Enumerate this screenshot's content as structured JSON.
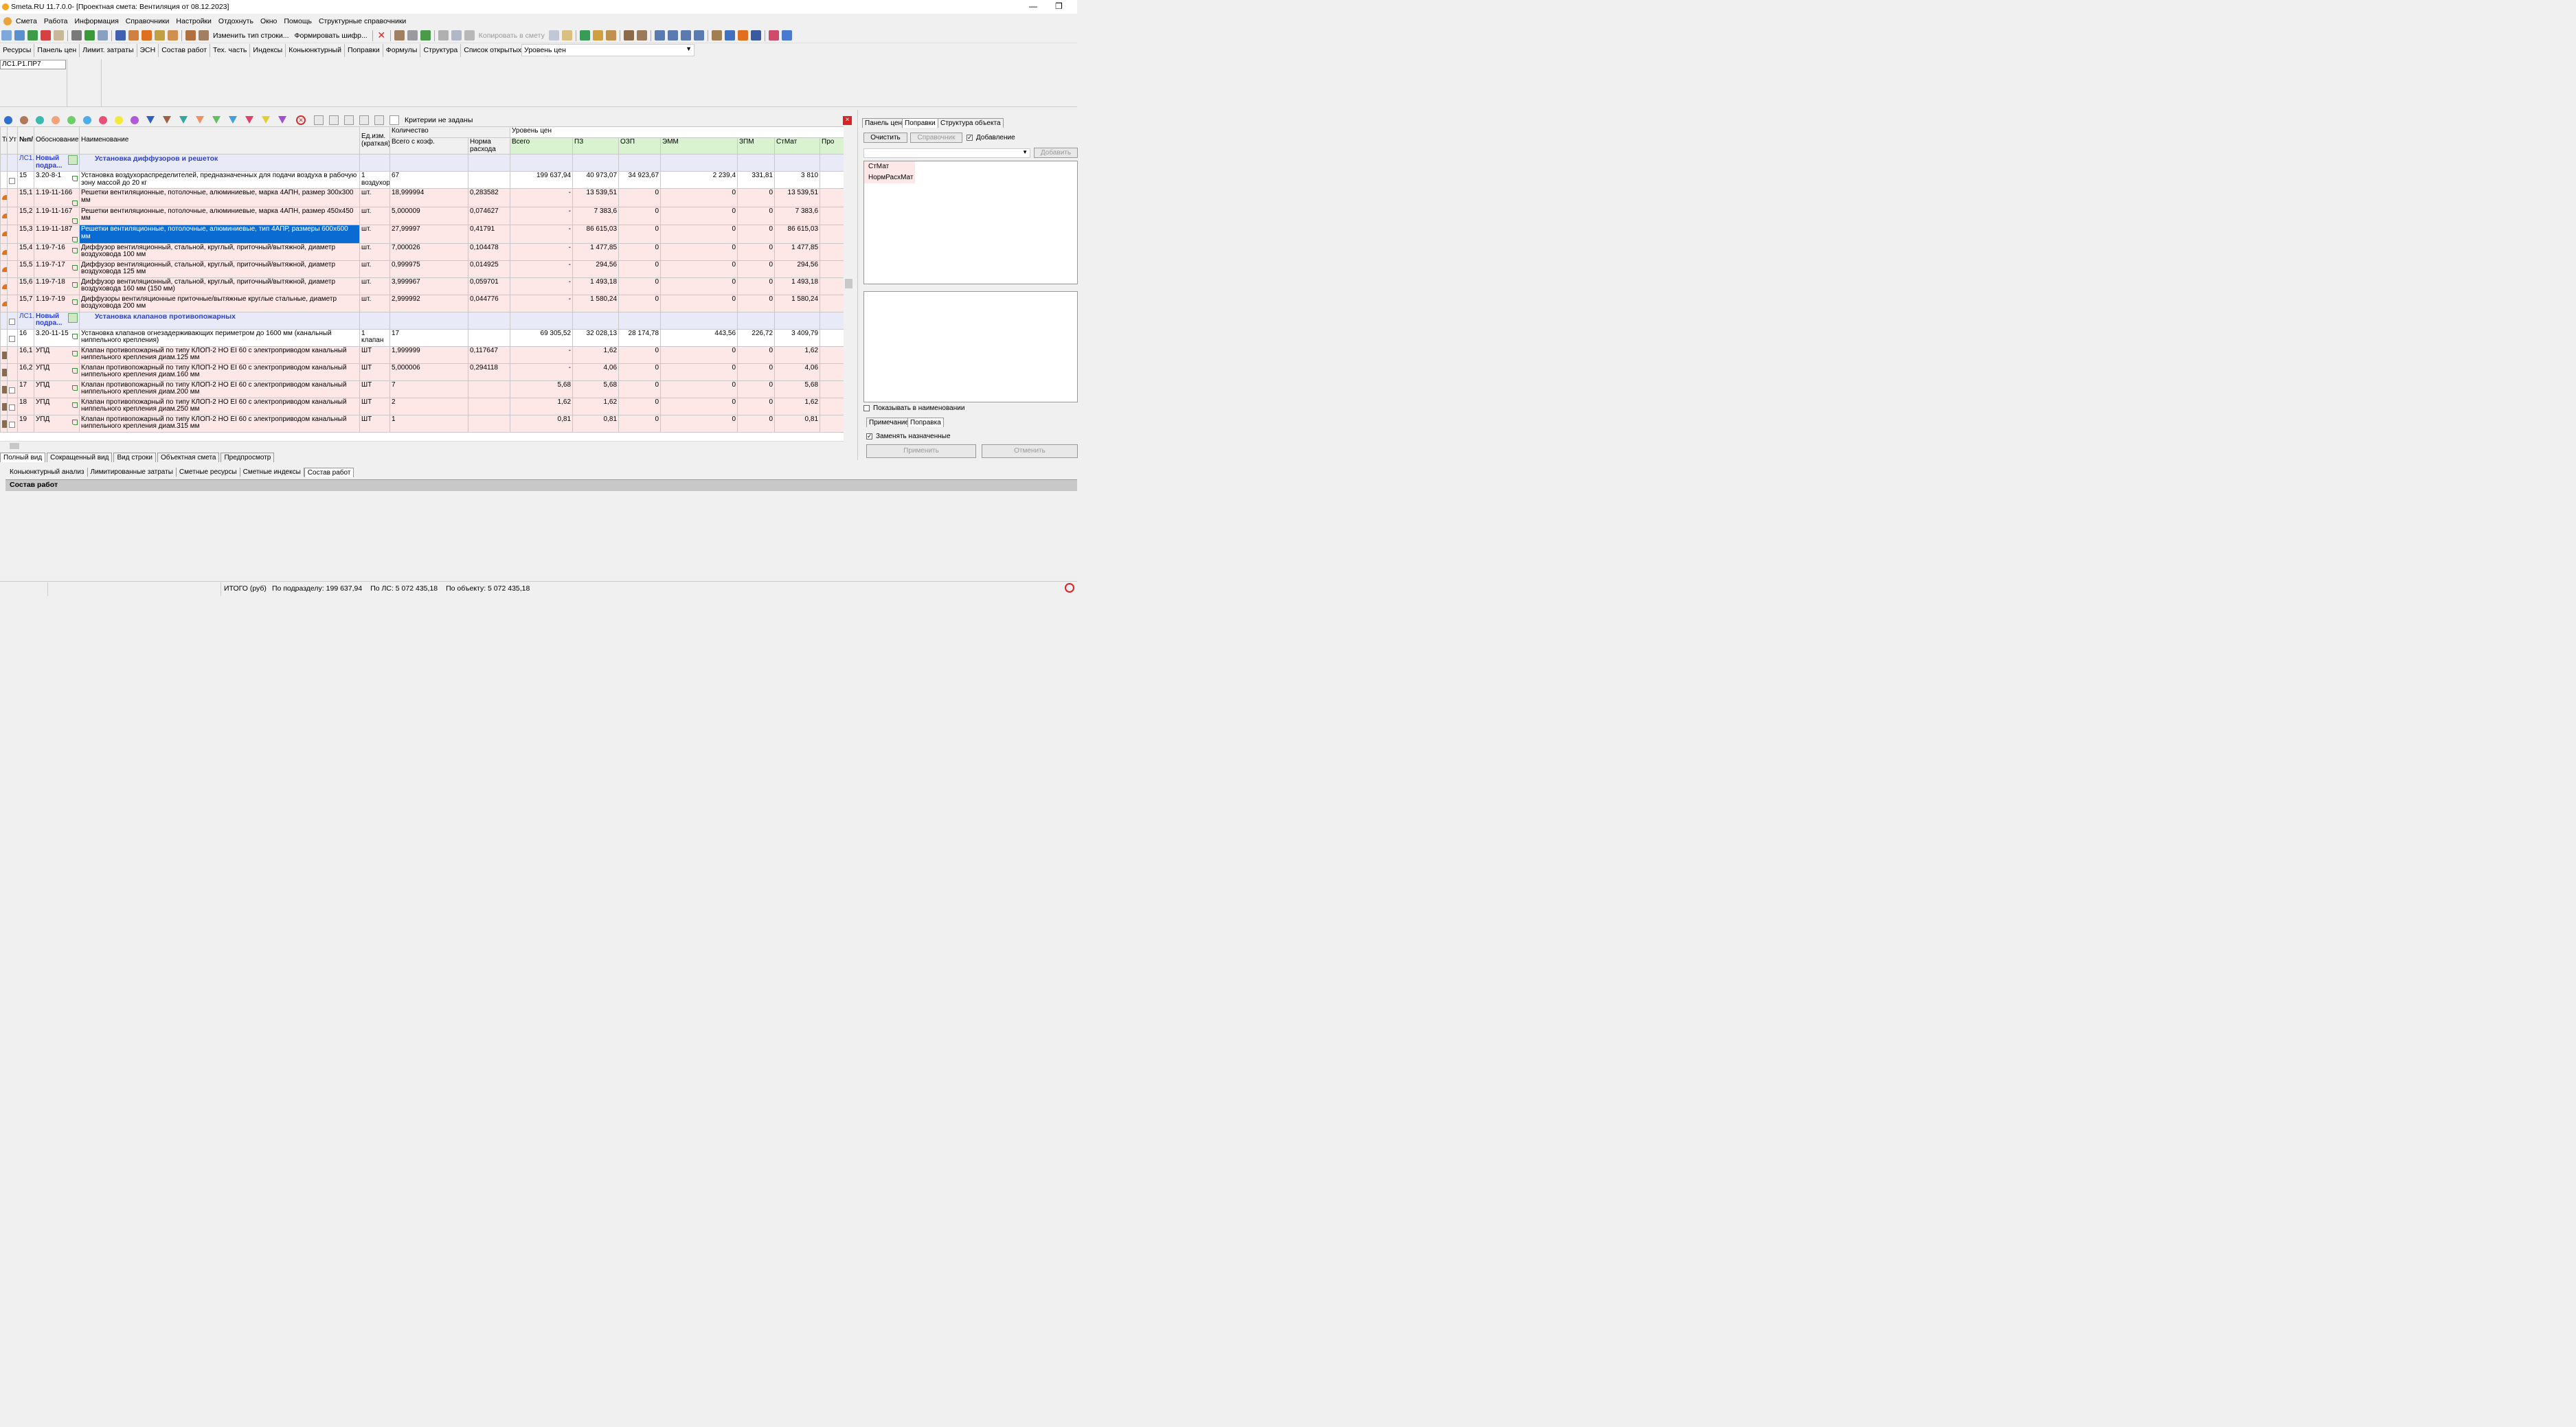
{
  "titlebar": {
    "app": "Smeta.RU  11.7.0.0",
    "doc": "  - [Проектная смета: Вентиляция от 08.12.2023]",
    "minimize": "—",
    "restore": "❐"
  },
  "menu": [
    "Смета",
    "Работа",
    "Информация",
    "Справочники",
    "Настройки",
    "Отдохнуть",
    "Окно",
    "Помощь",
    "Структурные справочники"
  ],
  "toolbar": {
    "change_row_type": "Изменить тип строки...",
    "form_code": "Формировать шифр...",
    "copy_to_estimate": "Копировать в смету"
  },
  "tabs": [
    "Ресурсы",
    "Панель цен",
    "Лимит. затраты",
    "ЭСН",
    "Состав работ",
    "Тех. часть",
    "Индексы",
    "Коньюнктурный",
    "Поправки",
    "Формулы",
    "Структура",
    "Список открытых окон ▾"
  ],
  "price_level_combo": "Уровень цен",
  "breadcrumb": "ЛС1.Р1.ПР7",
  "filter": {
    "dot_colors": [
      "#2f6fd0",
      "#b07a5a",
      "#3bb8b0",
      "#f3a37a",
      "#6fce6a",
      "#4aaee8",
      "#e8507a",
      "#f2ea3a",
      "#b05ad8"
    ],
    "funnel_colors": [
      "#3060c0",
      "#a06040",
      "#30a8a0",
      "#f09060",
      "#60c060",
      "#40a0e0",
      "#e04070",
      "#e0d030",
      "#a050d0"
    ],
    "criteria": "Критерии не заданы",
    "close": "×"
  },
  "grid": {
    "headers": {
      "type": "Ти",
      "ut": "Ут",
      "num": "№п/",
      "basis": "Обоснование",
      "name": "Наименование",
      "unit": "Ед.изм. (краткая)",
      "qty_group": "Количество",
      "qty_total": "Всего с коэф.",
      "norm": "Норма расхода",
      "level_group": "Уровень цен",
      "total": "Всего",
      "pz": "ПЗ",
      "ozp": "ОЗП",
      "emm": "ЭММ",
      "zpm": "ЗПМ",
      "stmat": "СтМат",
      "pro": "Про"
    },
    "rows": [
      {
        "kind": "sec",
        "mark": "ЛС1.",
        "basis": "Новый подра...",
        "name": "Установка диффузоров и решеток"
      },
      {
        "kind": "white",
        "chk": true,
        "num": "15",
        "basis": "3.20-8-1",
        "name": "Установка воздухораспределителей, предназначенных для подачи воздуха в рабочую зону массой до 20 кг",
        "unit": "1 воздухора",
        "qty": "67",
        "norm": "",
        "total": "199 637,94",
        "pz": "40 973,07",
        "ozp": "34 923,67",
        "emm": "2 239,4",
        "zpm": "331,81",
        "stmat": "3 810"
      },
      {
        "kind": "pink",
        "icon": "mat",
        "num": "15,1",
        "basis": "1.19-11-166",
        "name": "Решетки вентиляционные, потолочные, алюминиевые, марка 4АПН, размер 300х300 мм",
        "unit": "шт.",
        "qty": "18,999994",
        "norm": "0,283582",
        "total": "-",
        "pz": "13 539,51",
        "ozp": "0",
        "emm": "0",
        "zpm": "0",
        "stmat": "13 539,51"
      },
      {
        "kind": "pink",
        "icon": "mat",
        "num": "15,2",
        "basis": "1.19-11-167",
        "name": "Решетки вентиляционные, потолочные, алюминиевые, марка 4АПН, размер 450х450 мм",
        "unit": "шт.",
        "qty": "5,000009",
        "norm": "0,074627",
        "total": "-",
        "pz": "7 383,6",
        "ozp": "0",
        "emm": "0",
        "zpm": "0",
        "stmat": "7 383,6"
      },
      {
        "kind": "pink",
        "icon": "mat",
        "selected": true,
        "num": "15,3",
        "basis": "1.19-11-187",
        "name": "Решетки вентиляционные, потолочные, алюминиевые, тип 4АПР, размеры 600х600 мм",
        "unit": "шт.",
        "qty": "27,99997",
        "norm": "0,41791",
        "total": "-",
        "pz": "86 615,03",
        "ozp": "0",
        "emm": "0",
        "zpm": "0",
        "stmat": "86 615,03"
      },
      {
        "kind": "pink",
        "icon": "mat",
        "num": "15,4",
        "basis": "1.19-7-16",
        "name": "Диффузор вентиляционный, стальной, круглый, приточный/вытяжной, диаметр воздуховода 100 мм",
        "unit": "шт.",
        "qty": "7,000026",
        "norm": "0,104478",
        "total": "-",
        "pz": "1 477,85",
        "ozp": "0",
        "emm": "0",
        "zpm": "0",
        "stmat": "1 477,85"
      },
      {
        "kind": "pink",
        "icon": "mat",
        "num": "15,5",
        "basis": "1.19-7-17",
        "name": "Диффузор вентиляционный, стальной, круглый, приточный/вытяжной, диаметр воздуховода 125 мм",
        "unit": "шт.",
        "qty": "0,999975",
        "norm": "0,014925",
        "total": "-",
        "pz": "294,56",
        "ozp": "0",
        "emm": "0",
        "zpm": "0",
        "stmat": "294,56"
      },
      {
        "kind": "pink",
        "icon": "mat",
        "num": "15,6",
        "basis": "1.19-7-18",
        "name": "Диффузор вентиляционный, стальной, круглый, приточный/вытяжной, диаметр воздуховода 160 мм (150 мм)",
        "unit": "шт.",
        "qty": "3,999967",
        "norm": "0,059701",
        "total": "-",
        "pz": "1 493,18",
        "ozp": "0",
        "emm": "0",
        "zpm": "0",
        "stmat": "1 493,18"
      },
      {
        "kind": "pink",
        "icon": "mat",
        "num": "15,7",
        "basis": "1.19-7-19",
        "name": "Диффузоры вентиляционные приточные/вытяжные круглые стальные, диаметр воздуховода 200 мм",
        "unit": "шт.",
        "qty": "2,999992",
        "norm": "0,044776",
        "total": "-",
        "pz": "1 580,24",
        "ozp": "0",
        "emm": "0",
        "zpm": "0",
        "stmat": "1 580,24"
      },
      {
        "kind": "sec",
        "chk": true,
        "mark": "ЛС1.",
        "basis": "Новый подра...",
        "name": "Установка клапанов противопожарных"
      },
      {
        "kind": "white",
        "chk": true,
        "num": "16",
        "basis": "3.20-11-15",
        "name": "Установка клапанов огнезадерживающих периметром до 1600 мм (канальный ниппельного крепления)",
        "unit": "1 клапан",
        "qty": "17",
        "norm": "",
        "total": "69 305,52",
        "pz": "32 028,13",
        "ozp": "28 174,78",
        "emm": "443,56",
        "zpm": "226,72",
        "stmat": "3 409,79"
      },
      {
        "kind": "pink",
        "icon": "eq",
        "num": "16,1",
        "basis": "УПД",
        "name": "Клапан противопожарный по типу КЛОП-2 НО EI 60 с электроприводом канальный ниппельного крепления  диам.125 мм",
        "unit": "ШТ",
        "qty": "1,999999",
        "norm": "0,117647",
        "total": "-",
        "pz": "1,62",
        "ozp": "0",
        "emm": "0",
        "zpm": "0",
        "stmat": "1,62"
      },
      {
        "kind": "pink",
        "icon": "eq",
        "num": "16,2",
        "basis": "УПД",
        "name": "Клапан противопожарный по типу КЛОП-2 НО EI 60 с электроприводом канальный ниппельного крепления  диам.160 мм",
        "unit": "ШТ",
        "qty": "5,000006",
        "norm": "0,294118",
        "total": "-",
        "pz": "4,06",
        "ozp": "0",
        "emm": "0",
        "zpm": "0",
        "stmat": "4,06"
      },
      {
        "kind": "pink",
        "icon": "eq",
        "chk": true,
        "num": "17",
        "basis": "УПД",
        "name": "Клапан противопожарный по типу КЛОП-2 НО EI 60 с электроприводом канальный ниппельного крепления  диам.200 мм",
        "unit": "ШТ",
        "qty": "7",
        "norm": "",
        "total": "5,68",
        "pz": "5,68",
        "ozp": "0",
        "emm": "0",
        "zpm": "0",
        "stmat": "5,68"
      },
      {
        "kind": "pink",
        "icon": "eq",
        "chk": true,
        "num": "18",
        "basis": "УПД",
        "name": "Клапан противопожарный по типу КЛОП-2 НО EI 60 с электроприводом канальный ниппельного крепления  диам.250 мм",
        "unit": "ШТ",
        "qty": "2",
        "norm": "",
        "total": "1,62",
        "pz": "1,62",
        "ozp": "0",
        "emm": "0",
        "zpm": "0",
        "stmat": "1,62"
      },
      {
        "kind": "pink",
        "icon": "eq",
        "chk": true,
        "num": "19",
        "basis": "УПД",
        "name": "Клапан противопожарный по типу КЛОП-2 НО EI 60 с электроприводом канальный ниппельного крепления  диам.315 мм",
        "unit": "ШТ",
        "qty": "1",
        "norm": "",
        "total": "0,81",
        "pz": "0,81",
        "ozp": "0",
        "emm": "0",
        "zpm": "0",
        "stmat": "0,81"
      }
    ]
  },
  "view_tabs": [
    "Полный вид",
    "Сокращенный вид",
    "Вид строки",
    "Объектная смета",
    "Предпросмотр"
  ],
  "bottom_tabs": [
    "Коньюнктурный анализ",
    "Лимитированные затраты",
    "Сметные ресурсы",
    "Сметные индексы",
    "Состав работ"
  ],
  "work_panel_title": "Состав работ",
  "status": {
    "total_label": "ИТОГО (руб)",
    "by_subsection": "По подразделу: 199 637,94",
    "by_ls": "По ЛС: 5 072 435,18",
    "by_object": "По объекту: 5 072 435,18"
  },
  "right_panel": {
    "tabs": [
      "Панель цен",
      "Поправки",
      "Структура объекта"
    ],
    "clear_btn": "Очистить",
    "reference_btn": "Справочник",
    "add_check_label": "Добавление",
    "add_btn": "Добавить",
    "list": [
      "СтМат",
      "НормРасхМат"
    ],
    "show_in_name": "Показывать в наименовании",
    "subtabs": [
      "Примечание",
      "Поправка"
    ],
    "replace_assigned": "Заменять назначенные",
    "apply_btn": "Применить",
    "cancel_btn": "Отменить"
  }
}
